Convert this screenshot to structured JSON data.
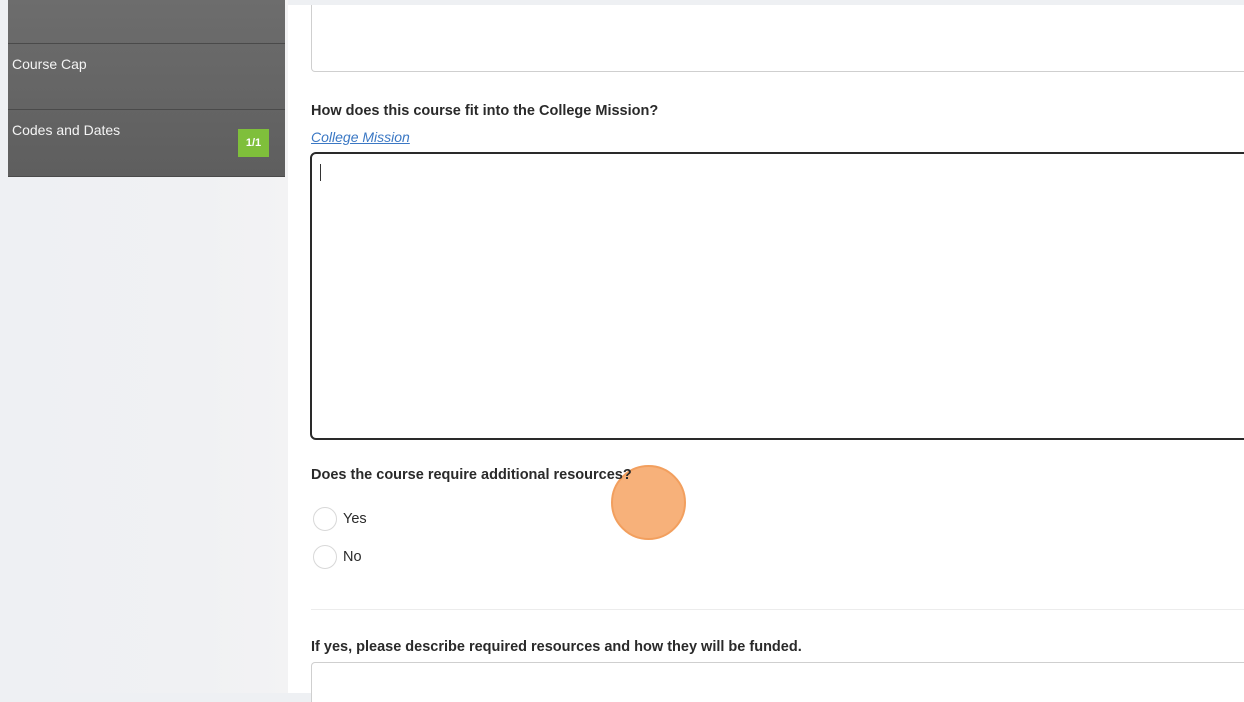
{
  "sidebar": {
    "items": [
      {
        "label": "Course Cap"
      },
      {
        "label": "Codes and Dates",
        "badge": "1/1"
      }
    ]
  },
  "form": {
    "mission_question": "How does this course fit into the College Mission?",
    "mission_link": "College Mission",
    "mission_value": "",
    "resources_question": "Does the course require additional resources?",
    "options": [
      "Yes",
      "No"
    ],
    "describe_question": "If yes, please describe required resources and how they will be funded."
  },
  "colors": {
    "badge": "#7fbf3b",
    "link": "#3b78c4",
    "click_indicator": "#f7b17a"
  }
}
